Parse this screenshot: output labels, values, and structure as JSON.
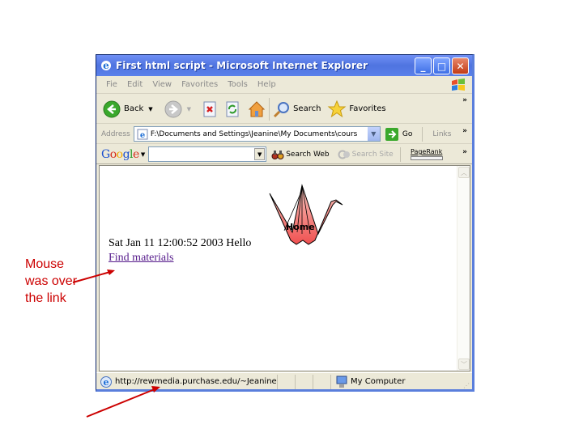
{
  "window": {
    "title": "First html script - Microsoft Internet Explorer",
    "controls": [
      "minimize",
      "maximize",
      "close"
    ]
  },
  "menubar": {
    "items": [
      "Fie",
      "Edit",
      "View",
      "Favorites",
      "Tools",
      "Help"
    ]
  },
  "toolbar": {
    "back_label": "Back",
    "search_label": "Search",
    "favorites_label": "Favorites",
    "more": "»"
  },
  "addressbar": {
    "label": "Address",
    "value": "F:\\Documents and Settings\\Jeanine\\My Documents\\cours",
    "go_label": "Go",
    "links_label": "Links",
    "more": "»"
  },
  "googlebar": {
    "logo": "Google",
    "search_value": "",
    "search_web_label": "Search Web",
    "search_site_label": "Search Site",
    "pagerank_label": "PageRank",
    "more": "»"
  },
  "page": {
    "text": "Sat Jan 11 12:00:52 2003 Hello",
    "link_text": "Find materials",
    "crane_label": "Home"
  },
  "statusbar": {
    "url": "http://rewmedia.purchase.edu/~Jeanine",
    "zone": "My Computer"
  },
  "annotation": {
    "text": "Mouse was over the link",
    "color": "#cc0000"
  },
  "colors": {
    "titlebar": "#4f74e0",
    "chrome": "#ece9d8",
    "visited_link": "#551a8b",
    "annotation": "#cc0000"
  }
}
